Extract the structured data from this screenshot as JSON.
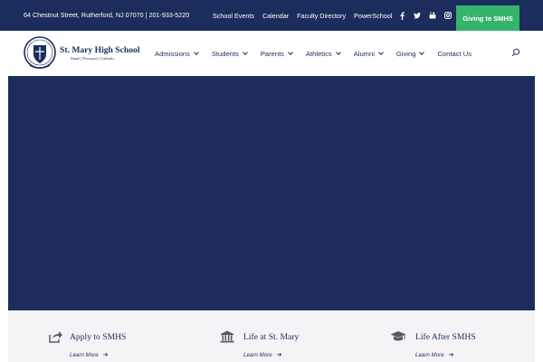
{
  "topbar": {
    "address": "64 Chestnut Street, Rutherford, NJ 07070 | 201-933-5220",
    "links": [
      "School Events",
      "Calendar",
      "Faculty Directory",
      "PowerSchool"
    ],
    "social": [
      "facebook-icon",
      "twitter-icon",
      "youtube-icon",
      "instagram-icon"
    ],
    "give_label": "Giving to SMHS"
  },
  "logo": {
    "name": "St. Mary High School",
    "tagline": "Small | Personal | Catholic"
  },
  "nav": {
    "items": [
      {
        "label": "Admissions",
        "dropdown": true
      },
      {
        "label": "Students",
        "dropdown": true
      },
      {
        "label": "Parents",
        "dropdown": true
      },
      {
        "label": "Athletics",
        "dropdown": true
      },
      {
        "label": "Alumni",
        "dropdown": true
      },
      {
        "label": "Giving",
        "dropdown": true
      },
      {
        "label": "Contact Us",
        "dropdown": false
      }
    ],
    "search_icon": "search-icon"
  },
  "features": [
    {
      "icon": "share-icon",
      "title": "Apply to SMHS",
      "link": "Learn More"
    },
    {
      "icon": "institution-icon",
      "title": "Life at St. Mary",
      "link": "Learn More"
    },
    {
      "icon": "graduation-cap-icon",
      "title": "Life After SMHS",
      "link": "Learn More"
    }
  ],
  "colors": {
    "navy": "#1a2d5c",
    "hero": "#1c2d5b",
    "green": "#36b36b",
    "strip": "#f4f4f6"
  }
}
